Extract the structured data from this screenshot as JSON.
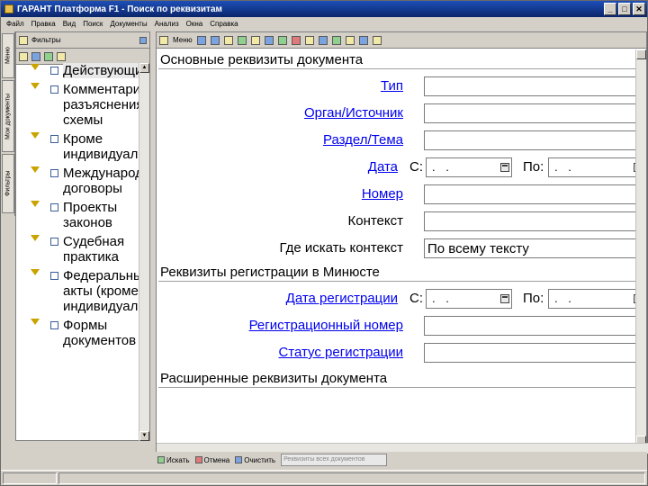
{
  "window": {
    "title": "ГАРАНТ Платформа F1 - Поиск по реквизитам"
  },
  "menu": [
    "Файл",
    "Правка",
    "Вид",
    "Поиск",
    "Документы",
    "Анализ",
    "Окна",
    "Справка"
  ],
  "left_tabs": [
    "Меню",
    "Мои документы",
    "Фильтры"
  ],
  "left_panel": {
    "title": "Фильтры",
    "items": [
      "Действующие",
      "Комментарии, разъяснения, схемы",
      "Кроме индивидуальных",
      "Международные договоры",
      "Проекты законов",
      "Судебная практика",
      "Федеральные акты (кроме индивидуальных)",
      "Формы документов"
    ]
  },
  "right_panel": {
    "toolbar_menu_label": "Меню",
    "sections": {
      "main": "Основные реквизиты документа",
      "reg": "Реквизиты регистрации в Минюсте",
      "ext": "Расширенные реквизиты документа"
    },
    "fields": {
      "type": "Тип",
      "organ": "Орган/Источник",
      "razdel": "Раздел/Тема",
      "date": "Дата",
      "number": "Номер",
      "context": "Контекст",
      "context_where": "Где искать контекст",
      "context_where_value": "По всему тексту",
      "reg_date": "Дата регистрации",
      "reg_number": "Регистрационный номер",
      "reg_status": "Статус регистрации"
    },
    "date_from": "С:",
    "date_to": "По:",
    "date_placeholder": ". ."
  },
  "bottom_bar": {
    "search": "Искать",
    "cancel": "Отмена",
    "clear": "Очистить",
    "combo": "Реквизиты всех документов"
  }
}
